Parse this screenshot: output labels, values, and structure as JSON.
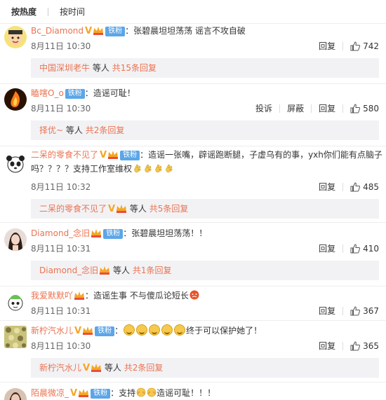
{
  "sort": {
    "hot": "按热度",
    "time": "按时间"
  },
  "comments": [
    {
      "user": "Bc_Diamond",
      "fan": "铁粉",
      "text": "：张碧晨坦坦荡荡 谣言不攻自破",
      "time": "8月11日 10:30",
      "actions": [
        "回复"
      ],
      "likes": "742",
      "reply": {
        "user": "中国深圳老牛",
        "text": "等人",
        "more": "共15条回复"
      }
    },
    {
      "user": "瞌嗐O_o",
      "fan": "铁粉",
      "text": "：造谣可耻！",
      "time": "8月11日 10:30",
      "actions": [
        "投诉",
        "屏蔽",
        "回复"
      ],
      "likes": "580",
      "reply": {
        "user": "择优~",
        "text": "等人",
        "more": "共2条回复"
      }
    },
    {
      "user": "二呆的零食不见了",
      "fan": "铁粉",
      "text": "：造谣一张嘴，辟谣跑断腿，子虚乌有的事，yxh你们能有点脑子",
      "text2": "吗？？？？支持工作室维权",
      "time": "8月11日 10:32",
      "actions": [
        "回复"
      ],
      "likes": "485",
      "reply": {
        "user": "二呆的零食不见了",
        "text": "等人",
        "more": "共5条回复"
      }
    },
    {
      "user": "Diamond_念旧",
      "fan": "铁粉",
      "text": "：张碧晨坦坦荡荡！！",
      "time": "8月11日 10:31",
      "actions": [
        "回复"
      ],
      "likes": "410",
      "reply": {
        "user": "Diamond_念旧",
        "text": "等人",
        "more": "共1条回复"
      }
    },
    {
      "user": "我爱默默吖",
      "text": "：造谣生事 不与傻瓜论短长",
      "time": "8月11日 10:31",
      "actions": [
        "回复"
      ],
      "likes": "367"
    },
    {
      "user": "新柠汽水儿",
      "fan": "铁粉",
      "text": "：",
      "text_after": "终于可以保护她了！",
      "time": "8月11日 10:30",
      "actions": [
        "回复"
      ],
      "likes": "365",
      "reply": {
        "user": "新柠汽水儿",
        "text": "等人",
        "more": "共2条回复"
      }
    },
    {
      "user": "陌晨微凉_",
      "fan": "铁粉",
      "text": "：支持",
      "text_after": "造谣可耻！！！"
    }
  ],
  "colors": {
    "username": "#eb7350",
    "fan_badge": "#5ba6e8",
    "reply_bg": "#f2f2f5"
  }
}
